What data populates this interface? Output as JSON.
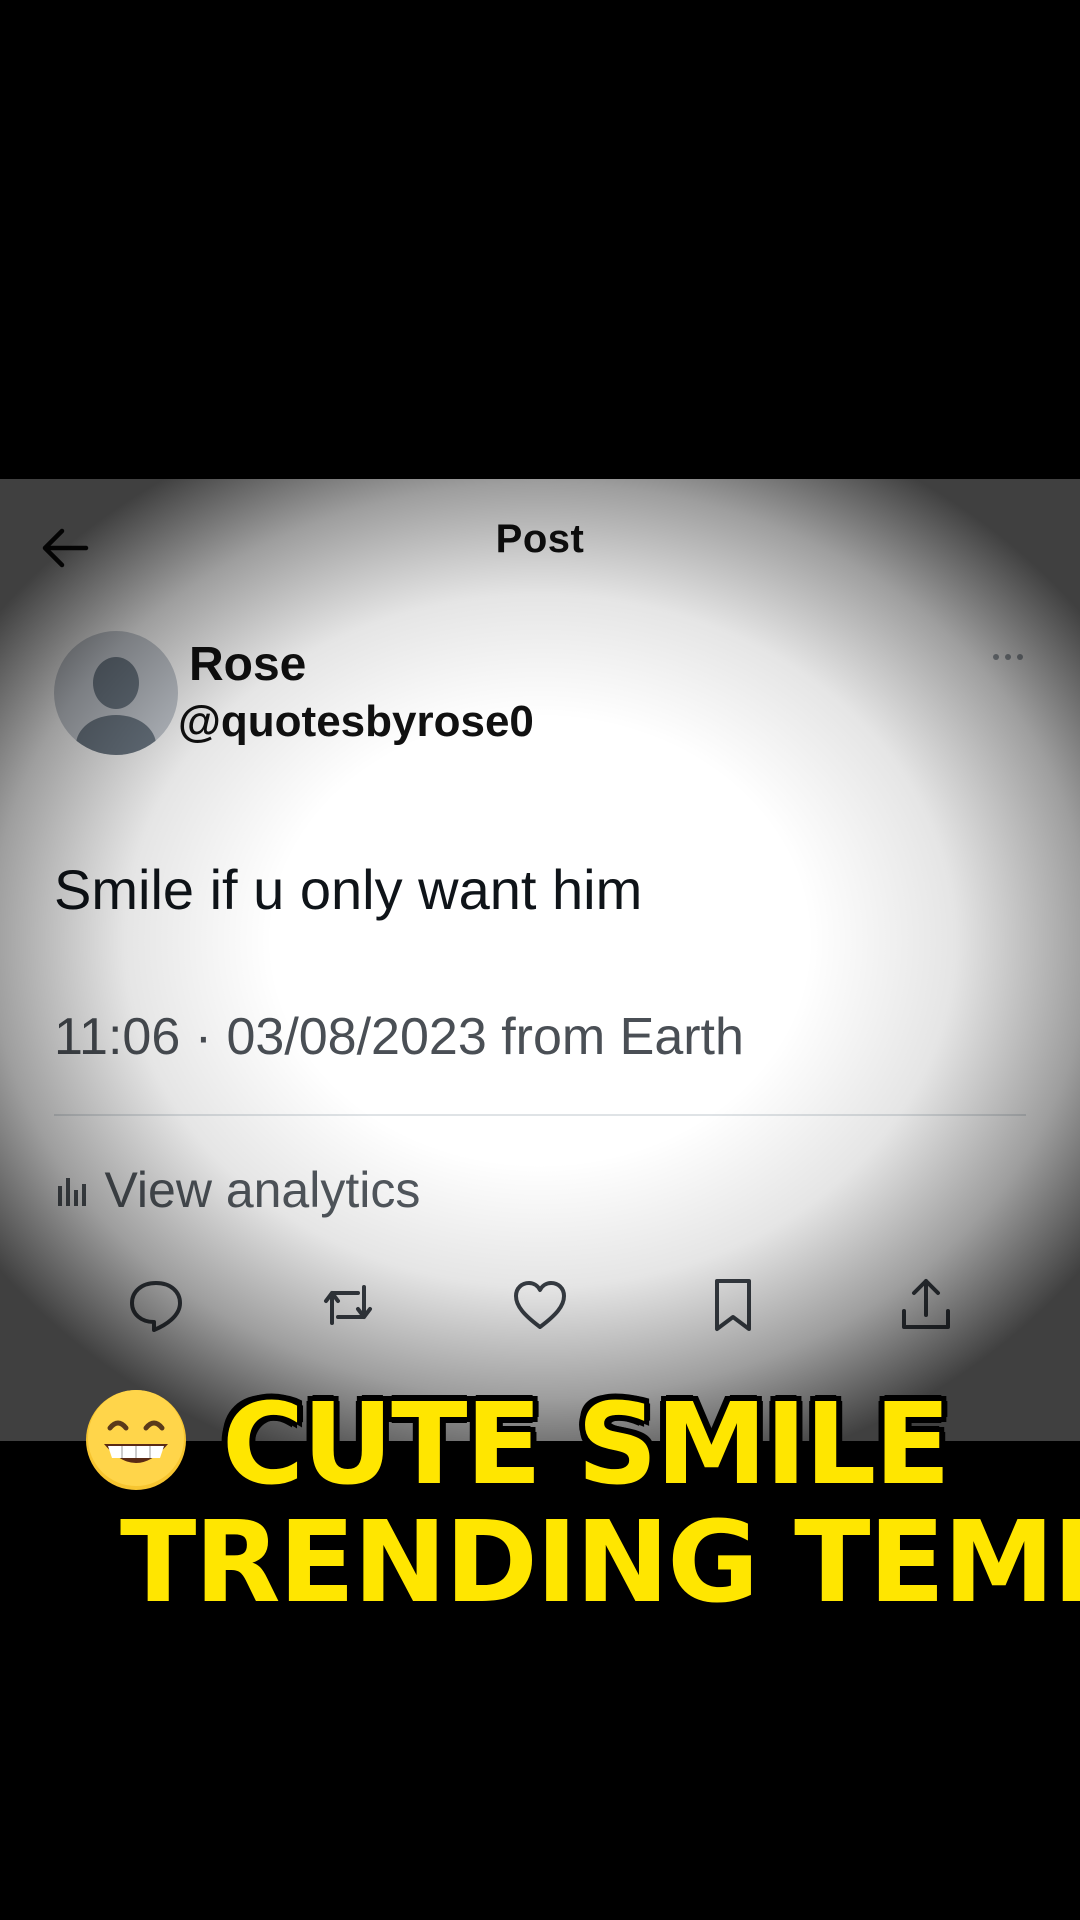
{
  "header": {
    "title": "Post",
    "back_icon": "arrow-left-icon"
  },
  "post": {
    "author_name": "Rose",
    "author_handle": "@quotesbyrose0",
    "text": "Smile if u only want him",
    "timestamp": "11:06 · 03/08/2023",
    "source": "from Earth",
    "analytics_label": "View analytics"
  },
  "actions": [
    {
      "name": "reply",
      "icon": "speech-bubble-icon"
    },
    {
      "name": "repost",
      "icon": "repost-arrows-icon"
    },
    {
      "name": "like",
      "icon": "heart-icon"
    },
    {
      "name": "bookmark",
      "icon": "bookmark-icon"
    },
    {
      "name": "share",
      "icon": "share-upload-icon"
    }
  ],
  "caption": {
    "emoji": "😁",
    "line1": "CUTE SMILE",
    "line2": "TRENDING TEMP"
  },
  "colors": {
    "background": "#000000",
    "caption_text": "#ffe600",
    "panel": "#ffffff",
    "body_text": "#0f1419",
    "meta_text": "#4a4f55"
  }
}
